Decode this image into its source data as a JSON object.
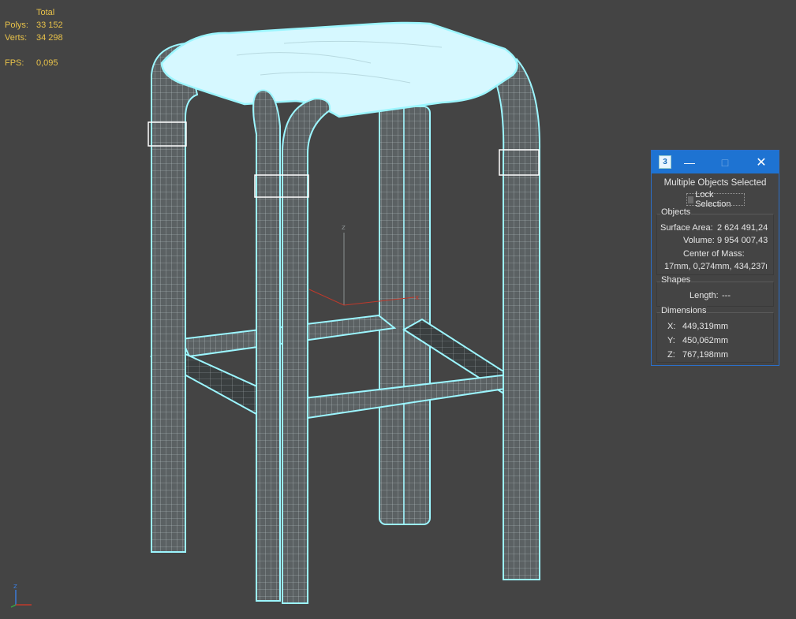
{
  "stats": {
    "header": "Total",
    "polys_label": "Polys:",
    "polys_value": "33 152",
    "verts_label": "Verts:",
    "verts_value": "34 298",
    "fps_label": "FPS:",
    "fps_value": "0,095"
  },
  "viewport": {
    "gizmo_z": "z",
    "gizmo_x": "x",
    "corner_z": "z"
  },
  "dialog": {
    "app_badge": "3",
    "heading": "Multiple Objects Selected",
    "lock_label": "Lock Selection",
    "objects": {
      "title": "Objects",
      "surface_area_label": "Surface Area:",
      "surface_area_value": "2 624 491,24",
      "volume_label": "Volume:",
      "volume_value": "9 954 007,43",
      "com_label": "Center of Mass:",
      "com_value": "17mm, 0,274mm, 434,237r"
    },
    "shapes": {
      "title": "Shapes",
      "length_label": "Length:",
      "length_value": "---"
    },
    "dimensions": {
      "title": "Dimensions",
      "x_label": "X:",
      "x_value": "449,319mm",
      "y_label": "Y:",
      "y_value": "450,062mm",
      "z_label": "Z:",
      "z_value": "767,198mm"
    }
  },
  "colors": {
    "background": "#444444",
    "wireframe": "#9cf6ff",
    "mesh_fill": "#5e6466",
    "seat_fill": "#d6f8ff",
    "stats_text": "#e8c24a",
    "titlebar": "#1e73d2"
  }
}
